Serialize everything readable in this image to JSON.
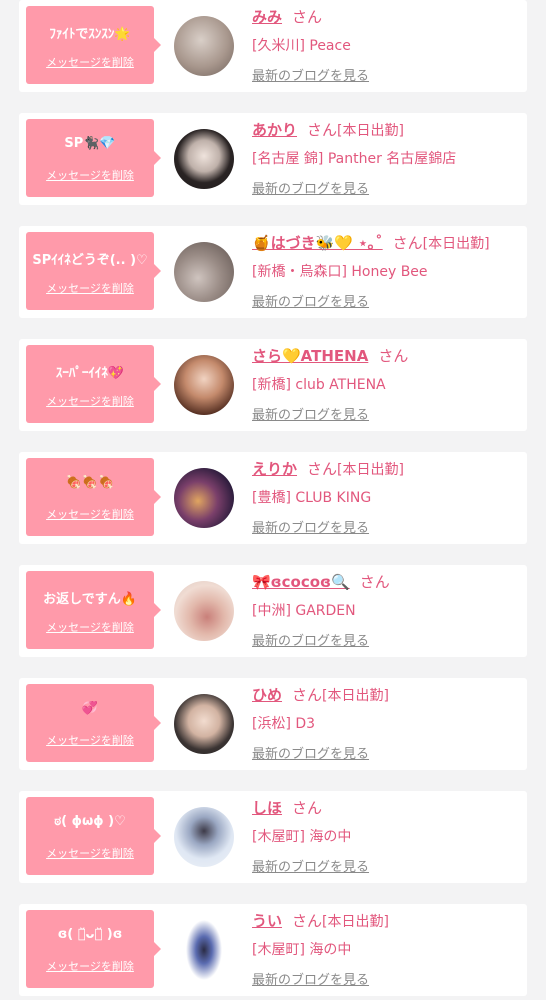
{
  "common": {
    "delete_label": "メッセージを削除",
    "san": "さん",
    "blog_link": "最新のブログを見る",
    "accent_color": "#e2577d",
    "bubble_color": "#ff9aaa"
  },
  "items": [
    {
      "message": "ﾌｧｲﾄでｽﾝｽﾝ🌟",
      "name": "みみ",
      "tag": "",
      "shop": "[久米川] Peace"
    },
    {
      "message": "SP🐈‍⬛💎",
      "name": "あかり",
      "tag": "[本日出勤]",
      "shop": "[名古屋 錦] Panther 名古屋錦店"
    },
    {
      "message": "SPｲｲﾈどうぞ(.. )♡",
      "name": "🍯はづき🐝💛 ⋆｡˚",
      "tag": "[本日出勤]",
      "shop": "[新橋・烏森口] Honey Bee"
    },
    {
      "message": "ｽｰﾊﾟｰｲｲﾈ💖",
      "name": "さら💛ATHENA",
      "tag": "",
      "shop": "[新橋] club ATHENA"
    },
    {
      "message": "🍖🍖🍖",
      "name": "えりか",
      "tag": "[本日出勤]",
      "shop": "[豊橋] CLUB KING"
    },
    {
      "message": "お返しですん🔥",
      "name": "🎀ɞcocoɞ🔍",
      "tag": "",
      "shop": "[中洲] GARDEN"
    },
    {
      "message": "💞",
      "name": "ひめ",
      "tag": "[本日出勤]",
      "shop": "[浜松] D3"
    },
    {
      "message": "ಠ( ɸωɸ )♡",
      "name": "しほ",
      "tag": "",
      "shop": "[木屋町] 海の中"
    },
    {
      "message": "ɞ( ･̆ᴗ･̆ )ɞ",
      "name": "うい",
      "tag": "[本日出勤]",
      "shop": "[木屋町] 海の中"
    }
  ]
}
